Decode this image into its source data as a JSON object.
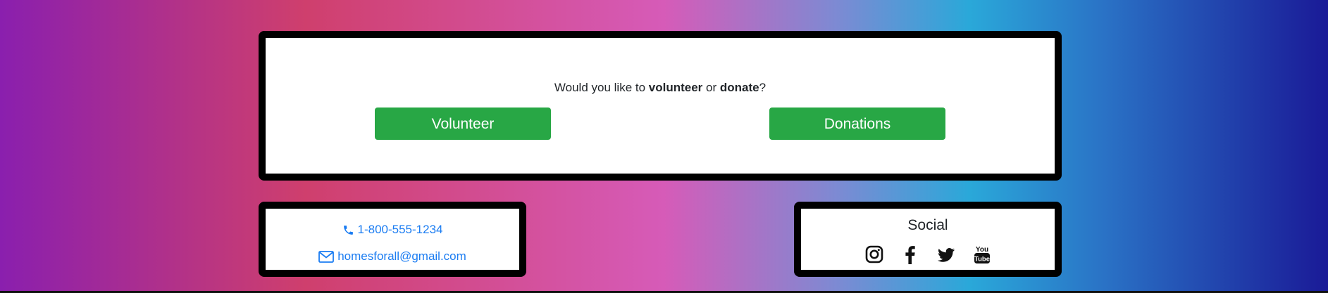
{
  "cta": {
    "question_before": "Would you like to ",
    "question_volunteer": "volunteer",
    "question_middle": " or ",
    "question_donate": "donate",
    "question_end": "?",
    "volunteer_button": "Volunteer",
    "donations_button": "Donations"
  },
  "contact": {
    "phone": "1-800-555-1234",
    "email": "homesforall@gmail.com",
    "phone_icon": "phone-icon",
    "email_icon": "envelope-icon"
  },
  "social": {
    "title": "Social",
    "icons": [
      "instagram-icon",
      "facebook-icon",
      "twitter-icon",
      "youtube-icon"
    ],
    "youtube_logo_text_top": "You",
    "youtube_logo_text_bottom": "Tube"
  },
  "colors": {
    "button": "#28a745",
    "link": "#1a7cf2",
    "card_border": "#000000"
  }
}
